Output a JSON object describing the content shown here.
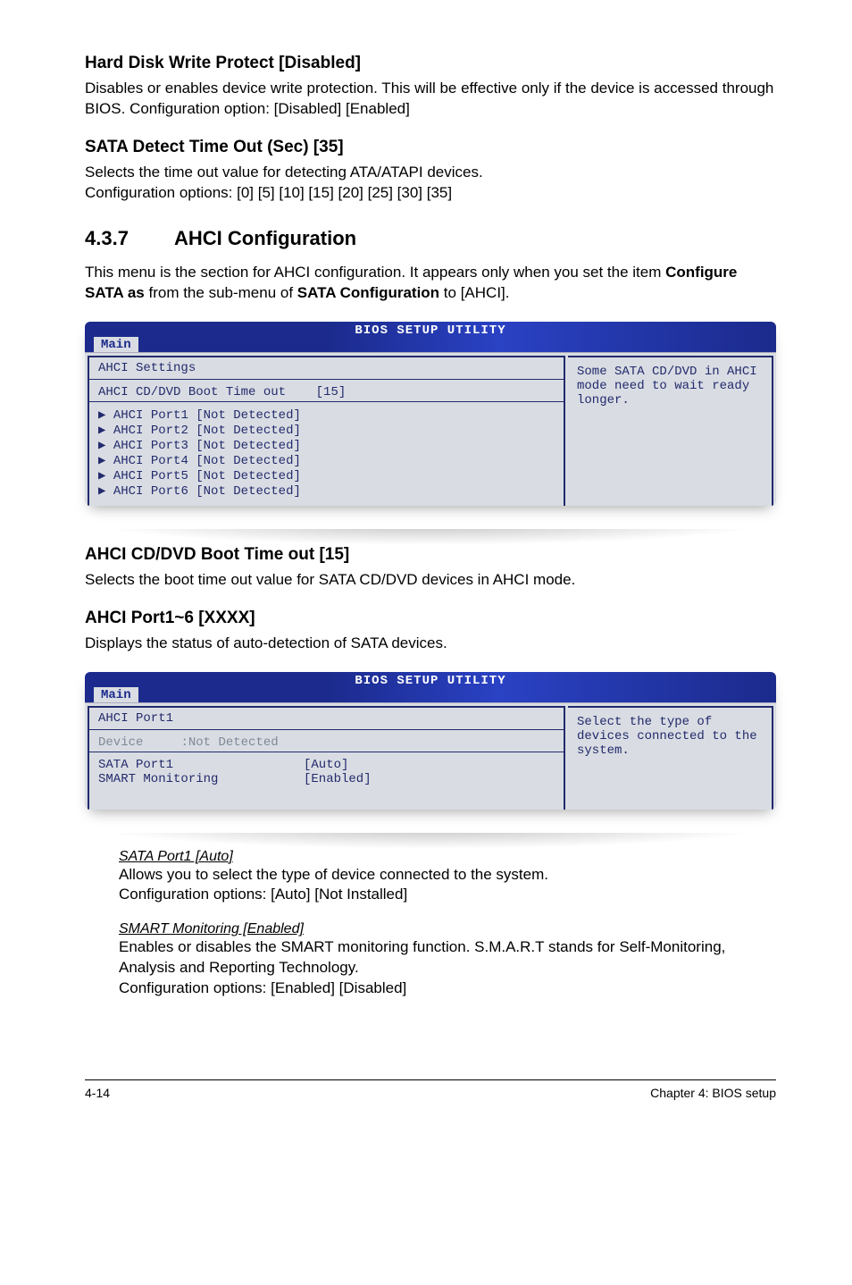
{
  "s1_title": "Hard Disk Write Protect [Disabled]",
  "s1_body": "Disables or enables device write protection. This will be effective only if the device is accessed through BIOS. Configuration option: [Disabled] [Enabled]",
  "s2_title": "SATA Detect Time Out (Sec) [35]",
  "s2_body_l1": "Selects the time out value for detecting ATA/ATAPI devices.",
  "s2_body_l2": "Configuration options: [0] [5] [10] [15] [20] [25] [30] [35]",
  "sec_num": "4.3.7",
  "sec_title": "AHCI Configuration",
  "sec_body_span1": "This menu is the section for AHCI configuration. It appears only when you set the item ",
  "sec_body_bold1": "Configure SATA as",
  "sec_body_span2": " from the sub-menu of ",
  "sec_body_bold2": "SATA Configuration",
  "sec_body_span3": " to [AHCI].",
  "bios_header": "BIOS SETUP UTILITY",
  "bios_tab": "Main",
  "bios1": {
    "heading": "AHCI Settings",
    "row_label": "AHCI CD/DVD Boot Time out",
    "row_value": "[15]",
    "ports": [
      "AHCI Port1 [Not Detected]",
      "AHCI Port2 [Not Detected]",
      "AHCI Port3 [Not Detected]",
      "AHCI Port4 [Not Detected]",
      "AHCI Port5 [Not Detected]",
      "AHCI Port6 [Not Detected]"
    ],
    "help": "Some SATA CD/DVD in AHCI mode need to wait ready longer."
  },
  "s3_title": "AHCI CD/DVD Boot Time out [15]",
  "s3_body": "Selects the boot time out value for SATA CD/DVD devices in AHCI mode.",
  "s4_title": "AHCI Port1~6 [XXXX]",
  "s4_body": "Displays the status of auto-detection of SATA devices.",
  "bios2": {
    "heading": "AHCI Port1",
    "dev_label": "Device",
    "dev_value": ":Not Detected",
    "rows": [
      {
        "label": "SATA Port1",
        "value": "[Auto]"
      },
      {
        "label": "SMART Monitoring",
        "value": "[Enabled]"
      }
    ],
    "help": "Select the type of devices connected to the system."
  },
  "sub1_title": "SATA Port1 [Auto]",
  "sub1_l1": "Allows you to select the type of device connected to the system.",
  "sub1_l2": "Configuration options: [Auto] [Not Installed]",
  "sub2_title": "SMART Monitoring [Enabled]",
  "sub2_l1": "Enables or disables the SMART monitoring function. S.M.A.R.T stands for Self-Monitoring, Analysis and Reporting Technology.",
  "sub2_l2": "Configuration options: [Enabled] [Disabled]",
  "footer_left": "4-14",
  "footer_right": "Chapter 4: BIOS setup"
}
